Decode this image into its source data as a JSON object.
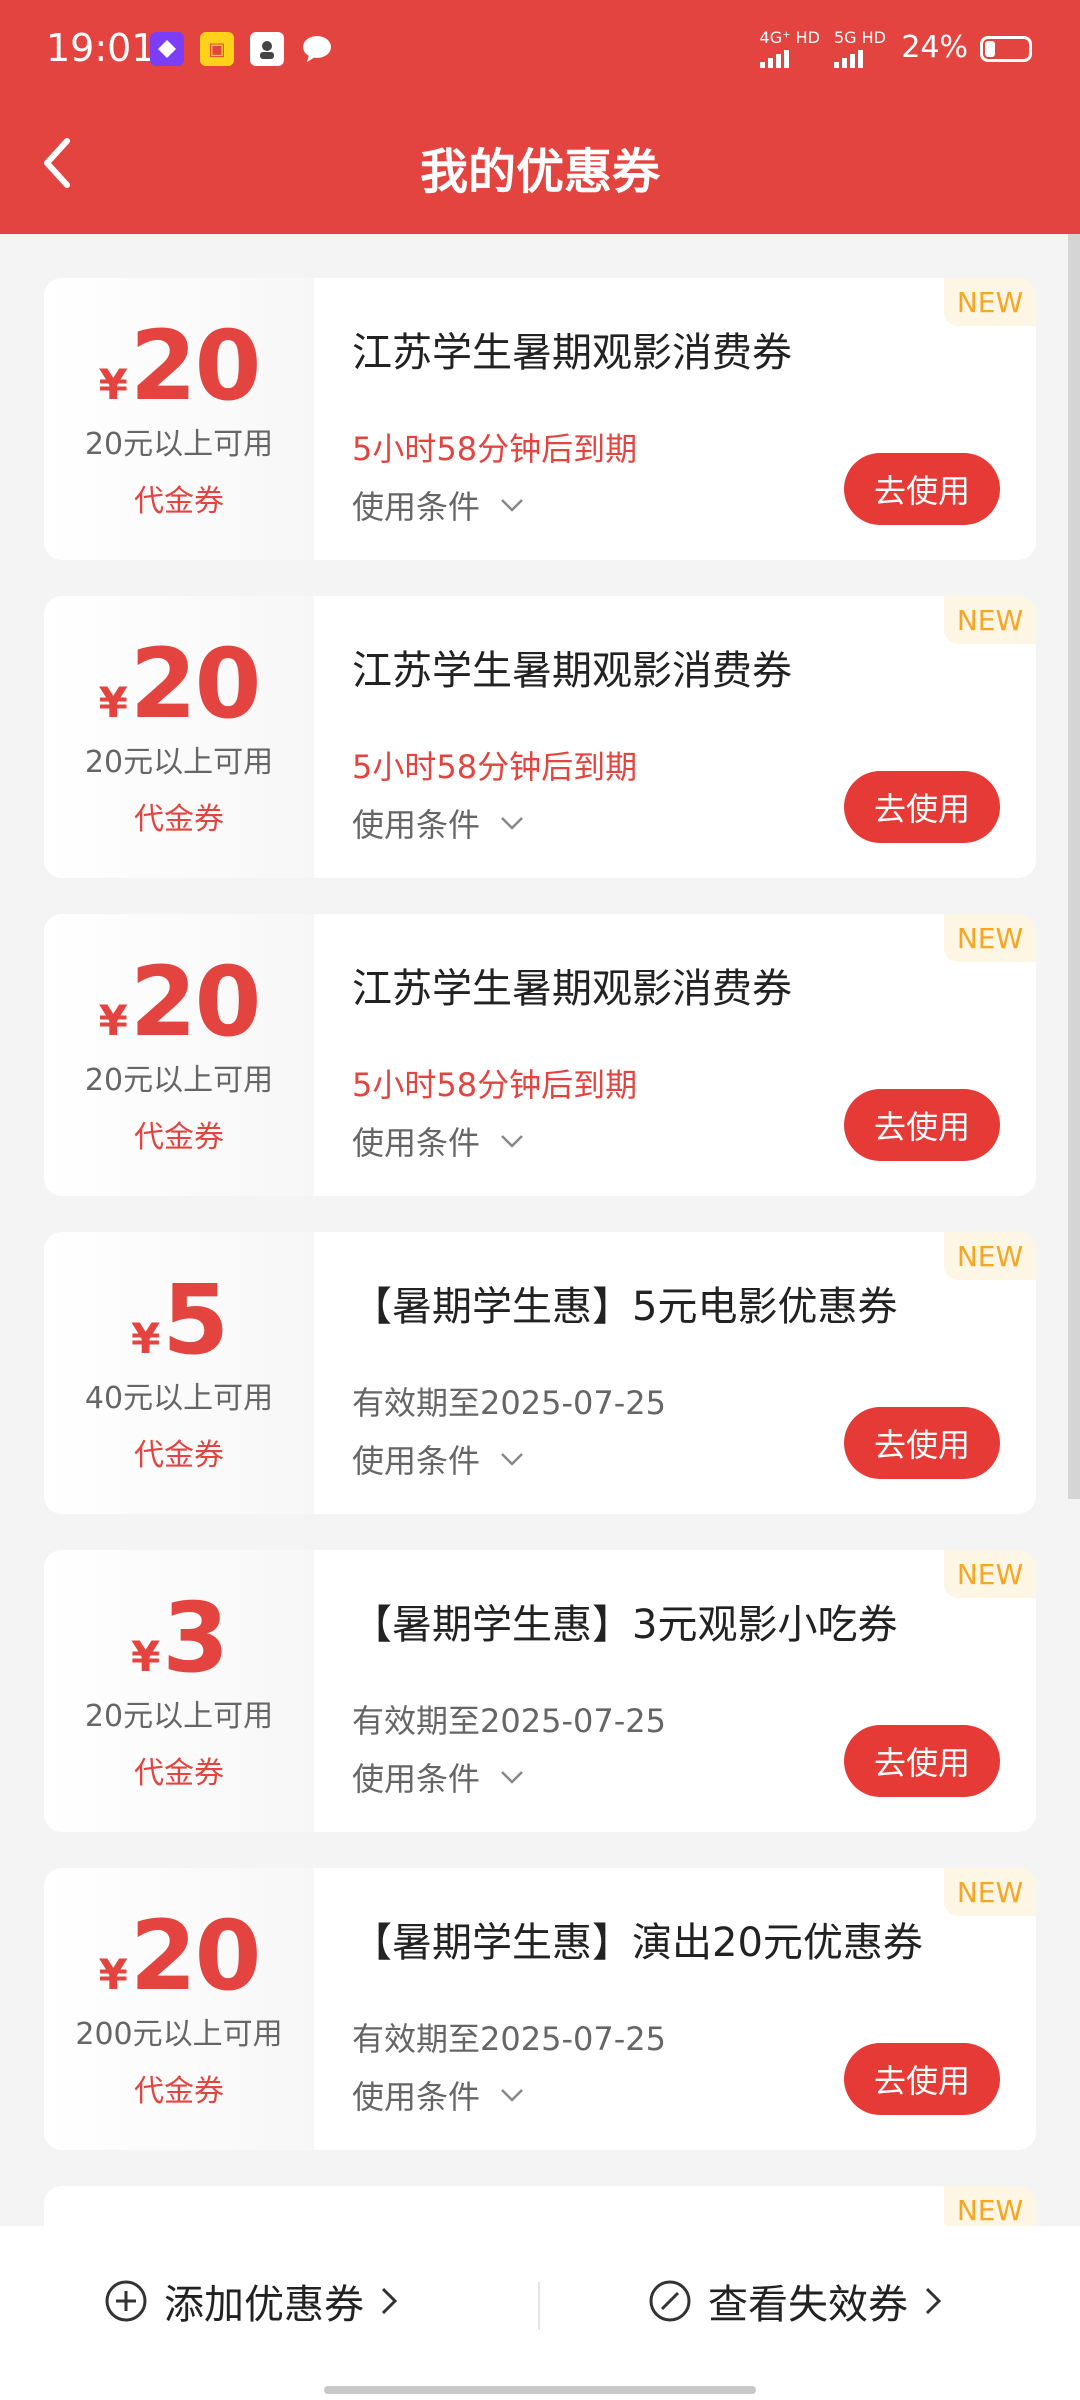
{
  "status_bar": {
    "time": "19:01",
    "network_1": "4G⁺ HD",
    "network_2": "5G HD",
    "battery_text": "24%",
    "battery_level": 0.24
  },
  "header": {
    "title": "我的优惠券"
  },
  "coupons": [
    {
      "currency": "¥",
      "amount": "20",
      "threshold": "20元以上可用",
      "type": "代金券",
      "title": "江苏学生暑期观影消费券",
      "expiry": "5小时58分钟后到期",
      "expiry_style": "red",
      "conditions": "使用条件",
      "button": "去使用",
      "badge": "NEW"
    },
    {
      "currency": "¥",
      "amount": "20",
      "threshold": "20元以上可用",
      "type": "代金券",
      "title": "江苏学生暑期观影消费券",
      "expiry": "5小时58分钟后到期",
      "expiry_style": "red",
      "conditions": "使用条件",
      "button": "去使用",
      "badge": "NEW"
    },
    {
      "currency": "¥",
      "amount": "20",
      "threshold": "20元以上可用",
      "type": "代金券",
      "title": "江苏学生暑期观影消费券",
      "expiry": "5小时58分钟后到期",
      "expiry_style": "red",
      "conditions": "使用条件",
      "button": "去使用",
      "badge": "NEW"
    },
    {
      "currency": "¥",
      "amount": "5",
      "threshold": "40元以上可用",
      "type": "代金券",
      "title": "【暑期学生惠】5元电影优惠券",
      "expiry": "有效期至2025-07-25",
      "expiry_style": "gray",
      "conditions": "使用条件",
      "button": "去使用",
      "badge": "NEW"
    },
    {
      "currency": "¥",
      "amount": "3",
      "threshold": "20元以上可用",
      "type": "代金券",
      "title": "【暑期学生惠】3元观影小吃券",
      "expiry": "有效期至2025-07-25",
      "expiry_style": "gray",
      "conditions": "使用条件",
      "button": "去使用",
      "badge": "NEW"
    },
    {
      "currency": "¥",
      "amount": "20",
      "threshold": "200元以上可用",
      "type": "代金券",
      "title": "【暑期学生惠】演出20元优惠券",
      "expiry": "有效期至2025-07-25",
      "expiry_style": "gray",
      "conditions": "使用条件",
      "button": "去使用",
      "badge": "NEW"
    }
  ],
  "partial_card": {
    "badge": "NEW"
  },
  "footer": {
    "add_label": "添加优惠券",
    "invalid_label": "查看失效券"
  },
  "colors": {
    "brand_red": "#e3443f",
    "badge_orange": "#f5a623"
  }
}
